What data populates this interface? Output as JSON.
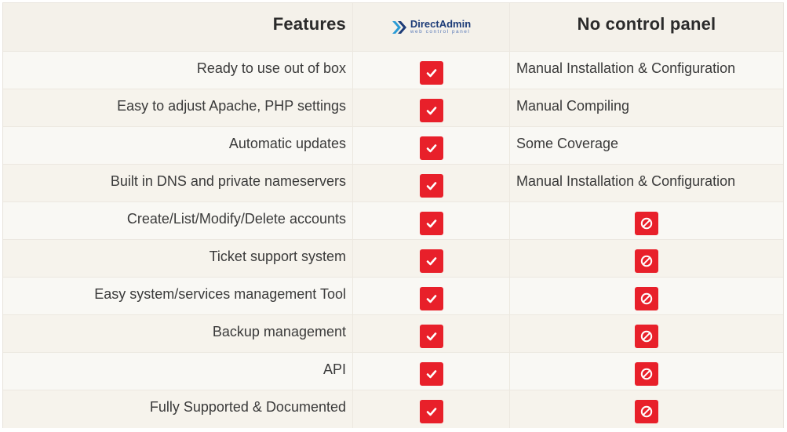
{
  "header": {
    "features": "Features",
    "directadmin_name": "DirectAdmin",
    "directadmin_sub": "web control panel",
    "no_panel": "No control panel"
  },
  "rows": [
    {
      "feature": "Ready to use out of box",
      "directadmin": "check-icon",
      "no_panel": "Manual Installation & Configuration"
    },
    {
      "feature": "Easy to adjust Apache, PHP settings",
      "directadmin": "check-icon",
      "no_panel": "Manual Compiling"
    },
    {
      "feature": "Automatic updates",
      "directadmin": "check-icon",
      "no_panel": "Some Coverage"
    },
    {
      "feature": "Built in DNS and private nameservers",
      "directadmin": "check-icon",
      "no_panel": "Manual Installation & Configuration"
    },
    {
      "feature": "Create/List/Modify/Delete accounts",
      "directadmin": "check-icon",
      "no_panel": "prohibited-icon"
    },
    {
      "feature": "Ticket support system",
      "directadmin": "check-icon",
      "no_panel": "prohibited-icon"
    },
    {
      "feature": "Easy system/services management Tool",
      "directadmin": "check-icon",
      "no_panel": "prohibited-icon"
    },
    {
      "feature": "Backup management",
      "directadmin": "check-icon",
      "no_panel": "prohibited-icon"
    },
    {
      "feature": "API",
      "directadmin": "check-icon",
      "no_panel": "prohibited-icon"
    },
    {
      "feature": "Fully Supported & Documented",
      "directadmin": "check-icon",
      "no_panel": "prohibited-icon"
    }
  ],
  "colors": {
    "badge_red": "#e8202a",
    "header_bg": "#f4f1ea",
    "row_alt_bg": "#f6f3ec",
    "text": "#3a3a3a",
    "logo_blue": "#1d3c78"
  }
}
